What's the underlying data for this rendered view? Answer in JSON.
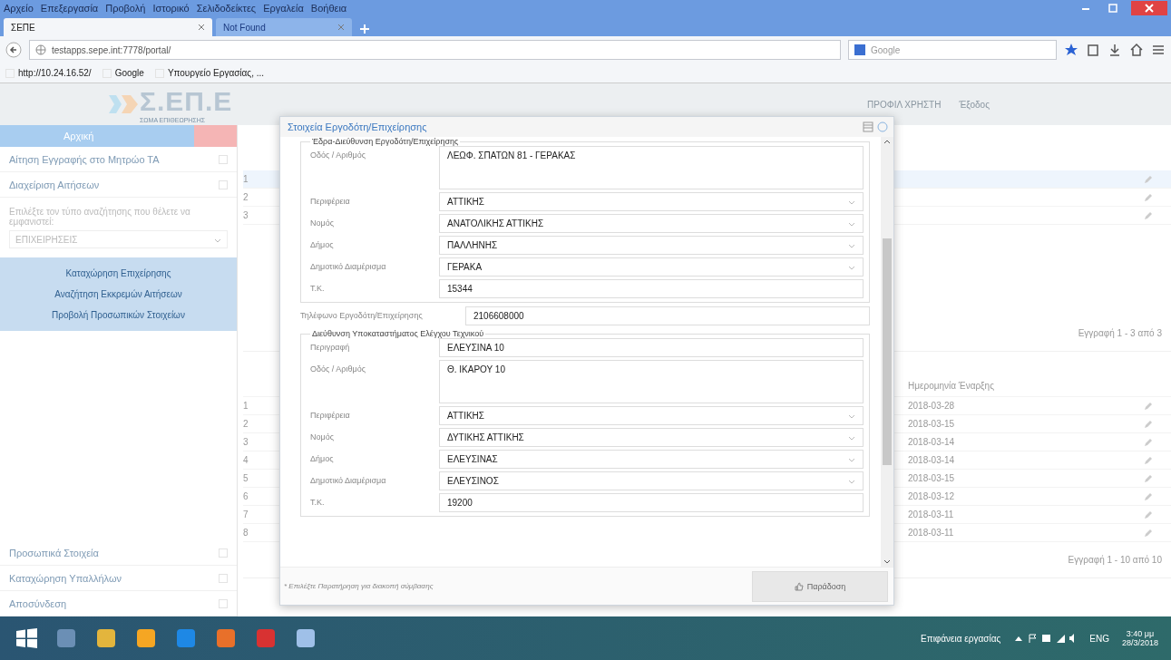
{
  "browser": {
    "menu": [
      "Αρχείο",
      "Επεξεργασία",
      "Προβολή",
      "Ιστορικό",
      "Σελιδοδείκτες",
      "Εργαλεία",
      "Βοήθεια"
    ],
    "tabs": [
      {
        "label": "ΣΕΠΕ",
        "selected": true
      },
      {
        "label": "Not Found",
        "selected": false
      }
    ],
    "url": "testapps.sepe.int:7778/portal/",
    "search_placeholder": "Google",
    "bookmarks": [
      "http://10.24.16.52/",
      "Google",
      "Υπουργείο Εργασίας, ..."
    ]
  },
  "header": {
    "logo": "Σ.ΕΠ.Ε",
    "logo_subtitle": "ΣΩΜΑ ΕΠΙΘΕΩΡΗΣΗΣ",
    "user_links": [
      "ΠΡΟΦΙΛ ΧΡΗΣΤΗ",
      "Έξοδος"
    ]
  },
  "sidebar": {
    "header": "Αρχική",
    "items": [
      "Αίτηση Εγγραφής στο Μητρώο ΤΑ",
      "Διαχείριση Αιτήσεων"
    ],
    "filter_label": "Επιλέξτε τον τύπο αναζήτησης που θέλετε να εμφανιστεί:",
    "filter_value": "ΕΠΙΧΕΙΡΗΣΕΙΣ",
    "actions": [
      "Καταχώρηση Επιχείρησης",
      "Αναζήτηση Εκκρεμών Αιτήσεων",
      "Προβολή Προσωπικών Στοιχείων"
    ],
    "bottom_items": [
      "Προσωπικά Στοιχεία",
      "Καταχώρηση Υπαλλήλων",
      "Αποσύνδεση"
    ]
  },
  "main": {
    "table1": {
      "rows": [
        {
          "num": "1",
          "selected": true
        },
        {
          "num": "2",
          "selected": false
        },
        {
          "num": "3",
          "selected": false
        }
      ],
      "footer": "Εγγραφή 1 - 3 από 3"
    },
    "table2": {
      "date_column": "Ημερομηνία Έναρξης",
      "rows": [
        {
          "num": "1",
          "date": "2018-03-28"
        },
        {
          "num": "2",
          "date": "2018-03-15"
        },
        {
          "num": "3",
          "date": "2018-03-14"
        },
        {
          "num": "4",
          "date": "2018-03-14"
        },
        {
          "num": "5",
          "date": "2018-03-15"
        },
        {
          "num": "6",
          "date": "2018-03-12"
        },
        {
          "num": "7",
          "date": "2018-03-11"
        },
        {
          "num": "8",
          "date": "2018-03-11"
        }
      ],
      "footer": "Εγγραφή 1 - 10 από 10"
    }
  },
  "dialog": {
    "title": "Στοιχεία Εργοδότη/Επιχείρησης",
    "sections": [
      {
        "legend": "Έδρα-Διεύθυνση Εργοδότη/Επιχείρησης",
        "fields": [
          {
            "label": "Οδός / Αριθμός",
            "value": "ΛΕΩΦ. ΣΠΑΤΩΝ 81 - ΓΕΡΑΚΑΣ",
            "kind": "textarea"
          },
          {
            "label": "Περιφέρεια",
            "value": "ΑΤΤΙΚΗΣ",
            "kind": "select"
          },
          {
            "label": "Νομός",
            "value": "ΑΝΑΤΟΛΙΚΗΣ ΑΤΤΙΚΗΣ",
            "kind": "select"
          },
          {
            "label": "Δήμος",
            "value": "ΠΑΛΛΗΝΗΣ",
            "kind": "select"
          },
          {
            "label": "Δημοτικό Διαμέρισμα",
            "value": "ΓΕΡΑΚΑ",
            "kind": "select"
          },
          {
            "label": "Τ.Κ.",
            "value": "15344",
            "kind": "text"
          }
        ]
      },
      {
        "label": "Τηλέφωνο Εργοδότη/Επιχείρησης",
        "value": "2106608000",
        "kind": "text"
      },
      {
        "legend": "Διεύθυνση Υποκαταστήματος Ελέγχου Τεχνικού",
        "fields": [
          {
            "label": "Περιγραφή",
            "value": "ΕΛΕΥΣΙΝΑ 10",
            "kind": "text"
          },
          {
            "label": "Οδός / Αριθμός",
            "value": "Θ. ΙΚΑΡΟΥ 10",
            "kind": "textarea"
          },
          {
            "label": "Περιφέρεια",
            "value": "ΑΤΤΙΚΗΣ",
            "kind": "select"
          },
          {
            "label": "Νομός",
            "value": "ΔΥΤΙΚΗΣ ΑΤΤΙΚΗΣ",
            "kind": "select"
          },
          {
            "label": "Δήμος",
            "value": "ΕΛΕΥΣΙΝΑΣ",
            "kind": "select"
          },
          {
            "label": "Δημοτικό Διαμέρισμα",
            "value": "ΕΛΕΥΣΙΝΟΣ",
            "kind": "select"
          },
          {
            "label": "Τ.Κ.",
            "value": "19200",
            "kind": "text"
          }
        ]
      }
    ],
    "note": "* Επιλέξτε Παρατήρηση για διακοπή σύμβασης",
    "button": "Παράδοση"
  },
  "taskbar": {
    "desktop_label": "Επιφάνεια εργασίας",
    "lang": "ENG",
    "time": "3:40 μμ",
    "date": "28/3/2018"
  }
}
